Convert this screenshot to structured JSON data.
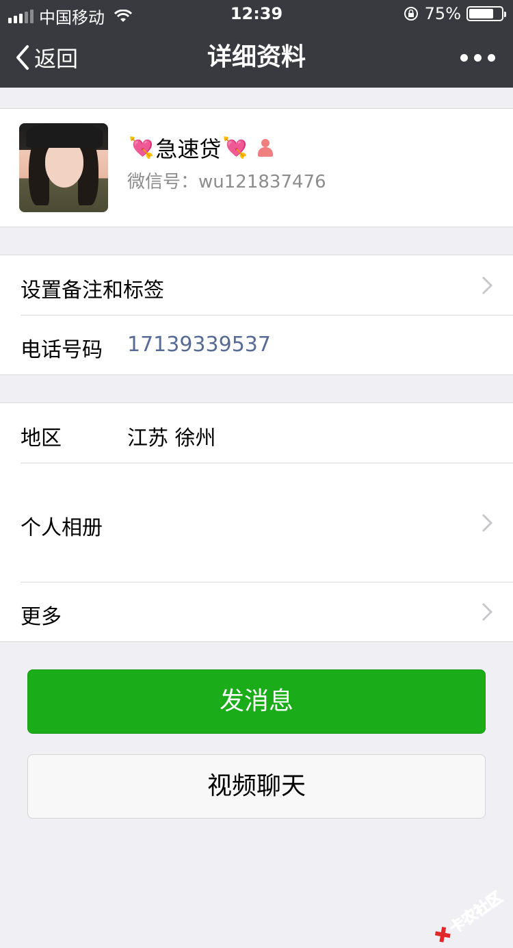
{
  "status_bar": {
    "carrier": "中国移动",
    "time": "12:39",
    "battery": "75%"
  },
  "nav": {
    "back_label": "返回",
    "title": "详细资料"
  },
  "profile": {
    "heart_emoji": "💘",
    "name": "急速贷",
    "wechat_id": "微信号：wu121837476"
  },
  "info": {
    "remark_label": "设置备注和标签",
    "phone_label": "电话号码",
    "phone_value": "17139339537",
    "region_label": "地区",
    "region_value": "江苏 徐州",
    "album_label": "个人相册",
    "more_label": "更多"
  },
  "actions": {
    "send_message": "发消息",
    "video_chat": "视频聊天"
  },
  "watermark": {
    "text": "卡农社区"
  },
  "colors": {
    "nav_bg": "#393a3f",
    "primary_green": "#1aad19",
    "link_blue": "#576b95"
  }
}
